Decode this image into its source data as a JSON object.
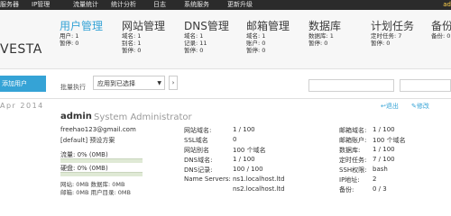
{
  "topbar": {
    "items": [
      "服务器",
      "IP管理",
      "流量统计",
      "统计分析",
      "日志",
      "系统服务",
      "更新升级"
    ],
    "right": "ad"
  },
  "logo": "VESTA",
  "nav": [
    {
      "title": "用户管理",
      "stats": [
        "用户: 1",
        "暂停: 0"
      ]
    },
    {
      "title": "网站管理",
      "stats": [
        "域名: 1",
        "别名: 1",
        "暂停: 0"
      ]
    },
    {
      "title": "DNS管理",
      "stats": [
        "域名: 1",
        "记录: 11",
        "暂停: 0"
      ]
    },
    {
      "title": "邮箱管理",
      "stats": [
        "域名: 1",
        "账户: 0",
        "暂停: 0"
      ]
    },
    {
      "title": "数据库",
      "stats": [
        "数据库: 1",
        "暂停: 0"
      ]
    },
    {
      "title": "计划任务",
      "stats": [
        "定时任务: 7",
        "暂停: 0"
      ]
    },
    {
      "title": "备份",
      "stats": [
        "备份: 0"
      ]
    }
  ],
  "toolbar": {
    "add_user": "添加用户",
    "batch_label": "批量执行",
    "select_value": "应用到已选择",
    "apply": "›"
  },
  "user": {
    "date": "Apr 2014",
    "name": "admin",
    "full_name": "System Administrator",
    "email": "freehao123@gmail.com",
    "package": "[default] 预设方案",
    "bandwidth_label": "流量: 0% (0MB)",
    "disk_label": "硬盘: 0% (0MB)",
    "bandwidth_pct": 0,
    "disk_pct": 0,
    "web_db": "网站: 0MB 数据库: 0MB",
    "mail_home": "邮箱: 0MB 用户目录: 0MB"
  },
  "col1": [
    {
      "label": "网站域名:",
      "value": "1 / 100"
    },
    {
      "label": "SSL域名",
      "value": "0"
    },
    {
      "label": "网站别名",
      "value": "100 个域名"
    },
    {
      "label": "DNS域名:",
      "value": "1 / 100"
    },
    {
      "label": "DNS记录:",
      "value": "100 / 100"
    },
    {
      "label": "Name Servers:",
      "value": "ns1.localhost.ltd"
    },
    {
      "label": "",
      "value": "ns2.localhost.ltd"
    }
  ],
  "col2": [
    {
      "label": "邮箱域名:",
      "value": "1 / 100"
    },
    {
      "label": "邮箱账户:",
      "value": "100 个域名"
    },
    {
      "label": "数据库:",
      "value": "1 / 100"
    },
    {
      "label": "定时任务:",
      "value": "7 / 100"
    },
    {
      "label": "SSH权限:",
      "value": "bash"
    },
    {
      "label": "IP地址:",
      "value": "2"
    },
    {
      "label": "备份:",
      "value": "0 / 3"
    }
  ],
  "actions": {
    "logout": "退出",
    "edit": "修改"
  }
}
